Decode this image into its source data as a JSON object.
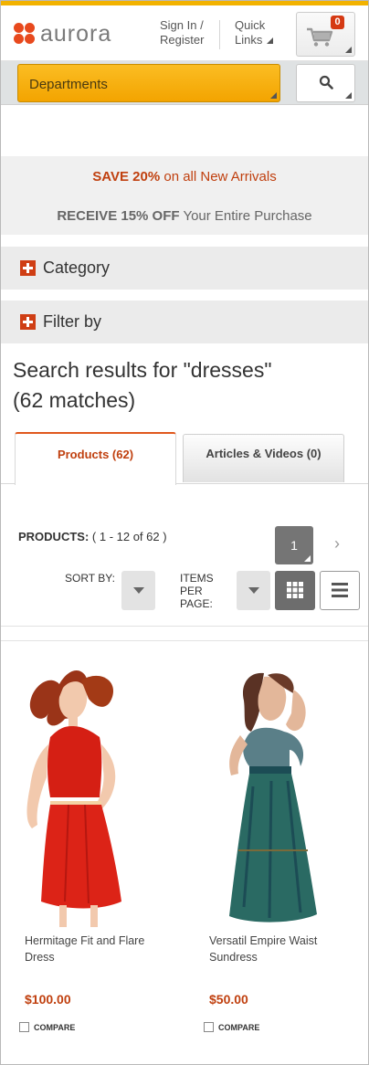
{
  "header": {
    "logo_text": "aurora",
    "sign_in_line1": "Sign In /",
    "sign_in_line2": "Register",
    "quick_links_line1": "Quick",
    "quick_links_line2": "Links",
    "cart_count": "0"
  },
  "nav": {
    "departments_label": "Departments"
  },
  "promo": {
    "line1_bold": "SAVE 20%",
    "line1_rest": " on all New Arrivals",
    "line2_bold": "RECEIVE 15% OFF",
    "line2_rest": " Your Entire Purchase"
  },
  "facets": {
    "category_label": "Category",
    "filter_label": "Filter by"
  },
  "results": {
    "line1": "Search results for \"dresses\"",
    "line2": "(62 matches)"
  },
  "tabs": [
    {
      "label": "Products (62)",
      "active": true
    },
    {
      "label": "Articles & Videos (0)",
      "active": false
    }
  ],
  "listing": {
    "products_label": "PRODUCTS:",
    "range": "(  1 - 12 of 62  )",
    "current_page": "1",
    "next_glyph": "›",
    "sort_by_label": "SORT BY:",
    "ipp_line1": "ITEMS",
    "ipp_line2": "PER",
    "ipp_line3": "PAGE:"
  },
  "products": [
    {
      "name_line1": "Hermitage Fit and Flare",
      "name_line2": "Dress",
      "price": "$100.00",
      "compare_label": "COMPARE"
    },
    {
      "name_line1": "Versatil Empire Waist",
      "name_line2": "Sundress",
      "price": "$50.00",
      "compare_label": "COMPARE"
    }
  ],
  "colors": {
    "accent_orange": "#c0400f",
    "brand_yellow": "#f2b200",
    "logo_orange": "#e8491d"
  }
}
